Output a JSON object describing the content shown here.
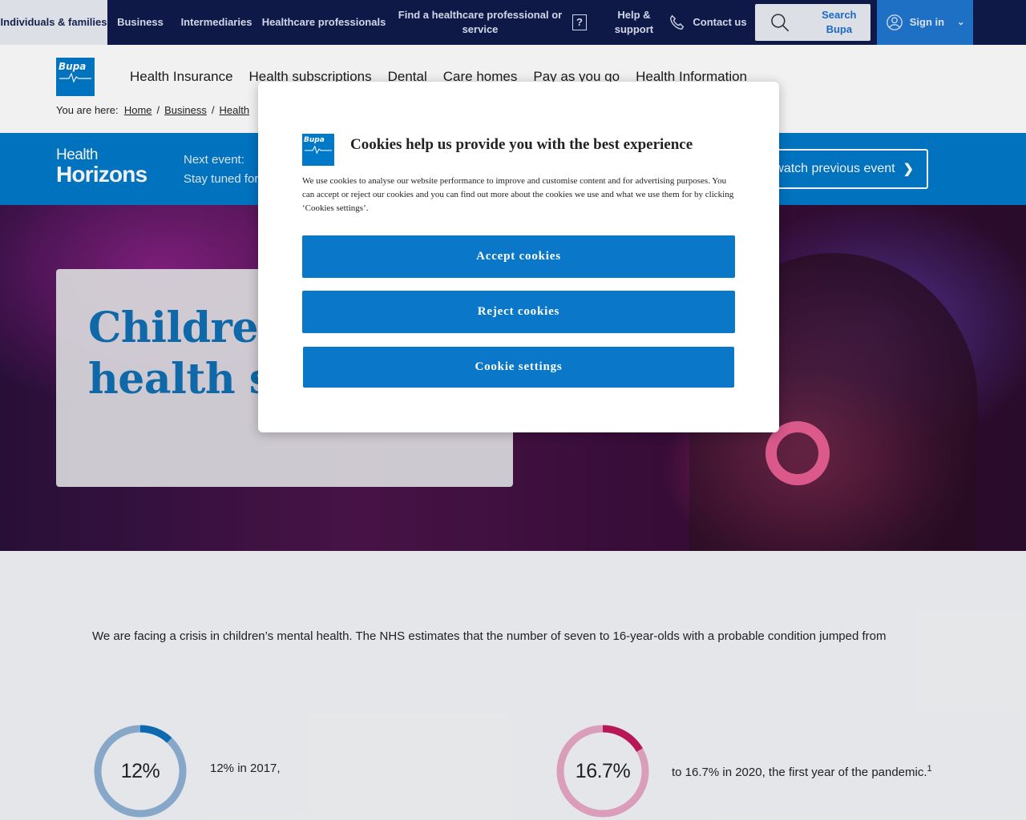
{
  "topnav": {
    "individuals": "Individuals & families",
    "business": "Business",
    "intermediaries": "Intermediaries",
    "healthcare_professionals": "Healthcare professionals",
    "find": "Find a healthcare professional or service",
    "help_icon_glyph": "?",
    "help": "Help & support",
    "contact": "Contact us",
    "search": "Search Bupa",
    "signin": "Sign in"
  },
  "header": {
    "logo_text": "Bupa",
    "nav": [
      "Health Insurance",
      "Health subscriptions",
      "Dental",
      "Care homes",
      "Pay as you go",
      "Health Information"
    ],
    "breadcrumb_prefix": "You are here:",
    "breadcrumb": [
      "Home",
      "Business",
      "Health"
    ]
  },
  "banner": {
    "logo_line1": "Health",
    "logo_line2": "Horizons",
    "next_event_label": "Next event:",
    "next_event_text": "Stay tuned for",
    "rewatch": "Rewatch previous event"
  },
  "hero": {
    "title": "Children mental health support"
  },
  "content": {
    "intro": "We are facing a crisis in children’s mental health. The NHS estimates that the number of seven to 16-year-olds with a probable condition jumped from",
    "stats": [
      {
        "value": "12%",
        "fraction": 0.12,
        "text": "12% in 2017,",
        "sup": "",
        "ring_color": "#8fb1d4",
        "arc_color": "#0a6fb8"
      },
      {
        "value": "16.7%",
        "fraction": 0.167,
        "text": "to 16.7% in 2020, the first year of the pandemic.",
        "sup": "1",
        "ring_color": "#e7a6c4",
        "arc_color": "#c2185b"
      }
    ]
  },
  "cookie_modal": {
    "logo_text": "Bupa",
    "title": "Cookies help us provide you with the best experience",
    "body": "We use cookies to analyse our website performance to improve and customise content and for advertising purposes. You can accept or reject our cookies and you can find out more about the cookies we use and what we use them for by clicking ‘Cookies settings’.",
    "accept": "Accept cookies",
    "reject": "Reject cookies",
    "settings": "Cookie settings"
  },
  "colors": {
    "nav_bg": "#0f1a4b",
    "brand_blue": "#0079c8",
    "button_blue": "#0a77c9"
  }
}
